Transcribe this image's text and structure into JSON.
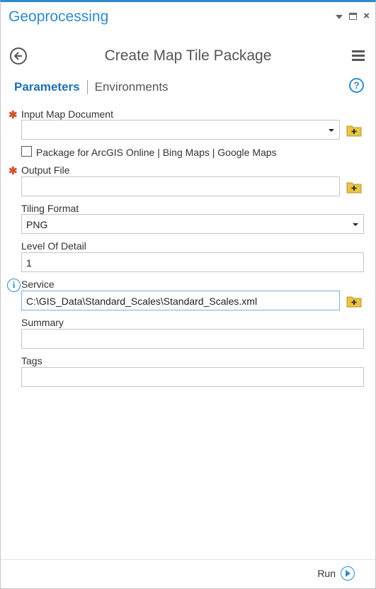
{
  "pane": {
    "title": "Geoprocessing",
    "controls": [
      "dropdown-icon",
      "maximize-icon",
      "close-icon"
    ]
  },
  "tool": {
    "title": "Create Map Tile Package"
  },
  "tabs": {
    "parameters": "Parameters",
    "environments": "Environments"
  },
  "fields": {
    "input_map_document": {
      "label": "Input Map Document",
      "value": "",
      "required": true
    },
    "package_checkbox": {
      "label": "Package for ArcGIS Online | Bing Maps | Google Maps",
      "checked": false
    },
    "output_file": {
      "label": "Output File",
      "value": "",
      "required": true
    },
    "tiling_format": {
      "label": "Tiling Format",
      "value": "PNG"
    },
    "level_of_detail": {
      "label": "Level Of Detail",
      "value": "1"
    },
    "service": {
      "label": "Service",
      "value": "C:\\GIS_Data\\Standard_Scales\\Standard_Scales.xml"
    },
    "summary": {
      "label": "Summary",
      "value": ""
    },
    "tags": {
      "label": "Tags",
      "value": ""
    }
  },
  "footer": {
    "run_label": "Run"
  },
  "colors": {
    "accent": "#2e8bcb",
    "required": "#d1542b",
    "folder": "#e8c547"
  }
}
